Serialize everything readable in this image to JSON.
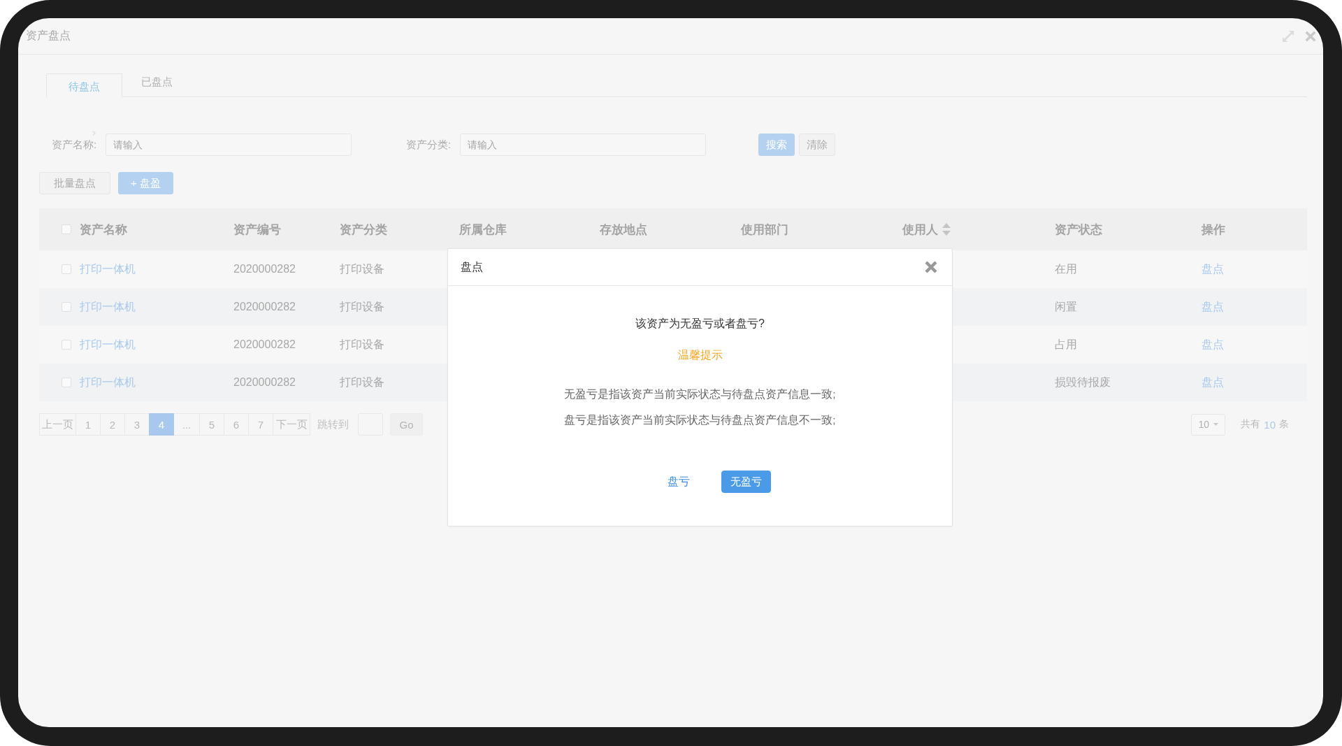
{
  "window": {
    "title": "资产盘点"
  },
  "tabs": [
    {
      "label": "待盘点",
      "selected": true
    },
    {
      "label": "已盘点",
      "selected": false
    }
  ],
  "filters": [
    {
      "label": "资产名称:",
      "placeholder": "请输入"
    },
    {
      "label": "资产分类:",
      "placeholder": "请输入"
    }
  ],
  "search_buttons": [
    {
      "label": "搜索",
      "kind": "primary"
    },
    {
      "label": "清除",
      "kind": "default"
    }
  ],
  "actions": [
    {
      "label": "批量盘点",
      "kind": "default"
    },
    {
      "label": "+ 盘盈",
      "kind": "primary"
    }
  ],
  "table": {
    "all_checked": false,
    "columns": [
      {
        "label": "资产名称",
        "sortable": false
      },
      {
        "label": "资产编号",
        "sortable": false
      },
      {
        "label": "资产分类",
        "sortable": false
      },
      {
        "label": "所属仓库",
        "sortable": false
      },
      {
        "label": "存放地点",
        "sortable": false
      },
      {
        "label": "使用部门",
        "sortable": false
      },
      {
        "label": "使用人",
        "sortable": true
      },
      {
        "label": "资产状态",
        "sortable": false
      },
      {
        "label": "操作",
        "sortable": false
      }
    ],
    "rows": [
      {
        "checked": false,
        "name": "打印一体机",
        "code": "2020000282",
        "category": "打印设备",
        "status": "在用",
        "action": "盘点"
      },
      {
        "checked": false,
        "name": "打印一体机",
        "code": "2020000282",
        "category": "打印设备",
        "status": "闲置",
        "action": "盘点"
      },
      {
        "checked": false,
        "name": "打印一体机",
        "code": "2020000282",
        "category": "打印设备",
        "status": "占用",
        "action": "盘点"
      },
      {
        "checked": false,
        "name": "打印一体机",
        "code": "2020000282",
        "category": "打印设备",
        "status": "损毁待报废",
        "action": "盘点"
      }
    ]
  },
  "pagination": {
    "prev": "上一页",
    "pages": [
      {
        "label": "1",
        "selected": false
      },
      {
        "label": "2",
        "selected": false
      },
      {
        "label": "3",
        "selected": false
      },
      {
        "label": "4",
        "selected": true
      },
      {
        "label": "...",
        "selected": false
      },
      {
        "label": "5",
        "selected": false
      },
      {
        "label": "6",
        "selected": false
      },
      {
        "label": "7",
        "selected": false
      }
    ],
    "next": "下一页",
    "jump_label": "跳转到",
    "go": "Go",
    "page_size": "10",
    "total_prefix": "共有",
    "total": "10",
    "total_suffix": "条"
  },
  "dialog": {
    "title": "盘点",
    "question": "该资产为无盈亏或者盘亏?",
    "tip_title": "温馨提示",
    "tips": [
      "无盈亏是指该资产当前实际状态与待盘点资产信息一致;",
      "盘亏是指该资产当前实际状态与待盘点资产信息不一致;"
    ],
    "buttons": [
      {
        "label": "盘亏",
        "kind": "link"
      },
      {
        "label": "无盈亏",
        "kind": "primary"
      }
    ]
  }
}
